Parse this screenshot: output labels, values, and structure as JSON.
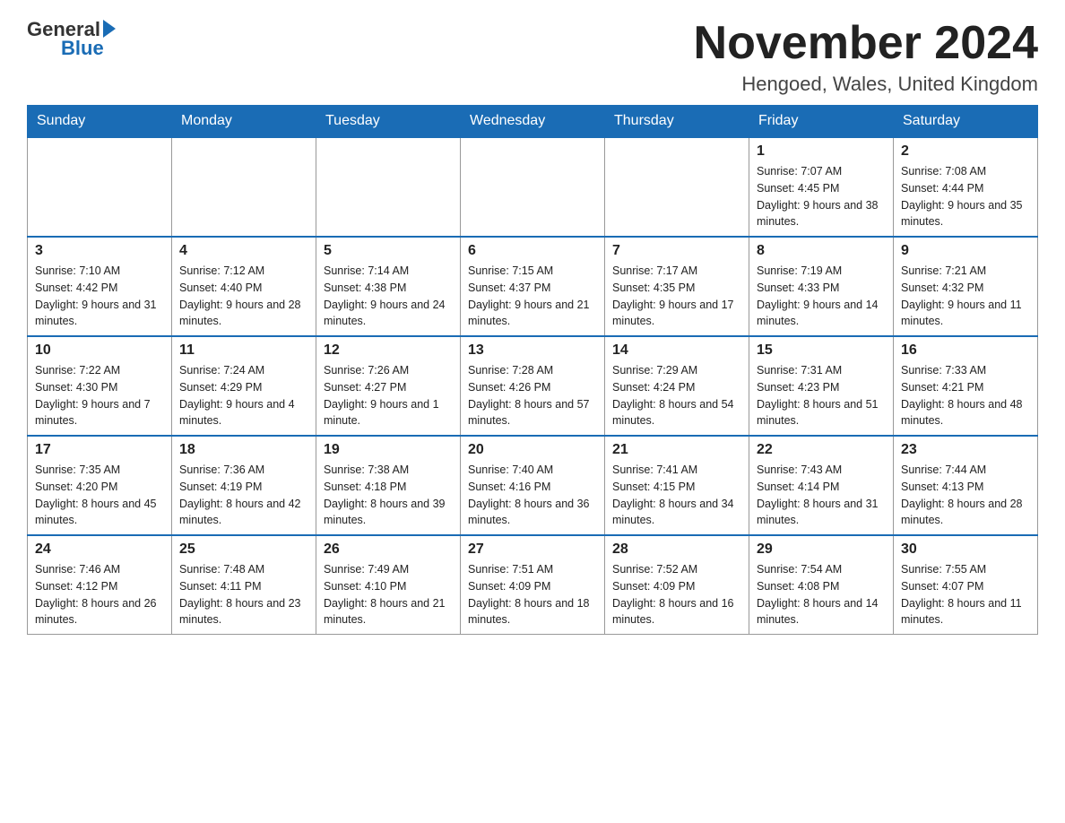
{
  "header": {
    "logo_general": "General",
    "logo_blue": "Blue",
    "month_title": "November 2024",
    "location": "Hengoed, Wales, United Kingdom"
  },
  "days_of_week": [
    "Sunday",
    "Monday",
    "Tuesday",
    "Wednesday",
    "Thursday",
    "Friday",
    "Saturday"
  ],
  "weeks": [
    [
      {
        "day": "",
        "sunrise": "",
        "sunset": "",
        "daylight": ""
      },
      {
        "day": "",
        "sunrise": "",
        "sunset": "",
        "daylight": ""
      },
      {
        "day": "",
        "sunrise": "",
        "sunset": "",
        "daylight": ""
      },
      {
        "day": "",
        "sunrise": "",
        "sunset": "",
        "daylight": ""
      },
      {
        "day": "",
        "sunrise": "",
        "sunset": "",
        "daylight": ""
      },
      {
        "day": "1",
        "sunrise": "Sunrise: 7:07 AM",
        "sunset": "Sunset: 4:45 PM",
        "daylight": "Daylight: 9 hours and 38 minutes."
      },
      {
        "day": "2",
        "sunrise": "Sunrise: 7:08 AM",
        "sunset": "Sunset: 4:44 PM",
        "daylight": "Daylight: 9 hours and 35 minutes."
      }
    ],
    [
      {
        "day": "3",
        "sunrise": "Sunrise: 7:10 AM",
        "sunset": "Sunset: 4:42 PM",
        "daylight": "Daylight: 9 hours and 31 minutes."
      },
      {
        "day": "4",
        "sunrise": "Sunrise: 7:12 AM",
        "sunset": "Sunset: 4:40 PM",
        "daylight": "Daylight: 9 hours and 28 minutes."
      },
      {
        "day": "5",
        "sunrise": "Sunrise: 7:14 AM",
        "sunset": "Sunset: 4:38 PM",
        "daylight": "Daylight: 9 hours and 24 minutes."
      },
      {
        "day": "6",
        "sunrise": "Sunrise: 7:15 AM",
        "sunset": "Sunset: 4:37 PM",
        "daylight": "Daylight: 9 hours and 21 minutes."
      },
      {
        "day": "7",
        "sunrise": "Sunrise: 7:17 AM",
        "sunset": "Sunset: 4:35 PM",
        "daylight": "Daylight: 9 hours and 17 minutes."
      },
      {
        "day": "8",
        "sunrise": "Sunrise: 7:19 AM",
        "sunset": "Sunset: 4:33 PM",
        "daylight": "Daylight: 9 hours and 14 minutes."
      },
      {
        "day": "9",
        "sunrise": "Sunrise: 7:21 AM",
        "sunset": "Sunset: 4:32 PM",
        "daylight": "Daylight: 9 hours and 11 minutes."
      }
    ],
    [
      {
        "day": "10",
        "sunrise": "Sunrise: 7:22 AM",
        "sunset": "Sunset: 4:30 PM",
        "daylight": "Daylight: 9 hours and 7 minutes."
      },
      {
        "day": "11",
        "sunrise": "Sunrise: 7:24 AM",
        "sunset": "Sunset: 4:29 PM",
        "daylight": "Daylight: 9 hours and 4 minutes."
      },
      {
        "day": "12",
        "sunrise": "Sunrise: 7:26 AM",
        "sunset": "Sunset: 4:27 PM",
        "daylight": "Daylight: 9 hours and 1 minute."
      },
      {
        "day": "13",
        "sunrise": "Sunrise: 7:28 AM",
        "sunset": "Sunset: 4:26 PM",
        "daylight": "Daylight: 8 hours and 57 minutes."
      },
      {
        "day": "14",
        "sunrise": "Sunrise: 7:29 AM",
        "sunset": "Sunset: 4:24 PM",
        "daylight": "Daylight: 8 hours and 54 minutes."
      },
      {
        "day": "15",
        "sunrise": "Sunrise: 7:31 AM",
        "sunset": "Sunset: 4:23 PM",
        "daylight": "Daylight: 8 hours and 51 minutes."
      },
      {
        "day": "16",
        "sunrise": "Sunrise: 7:33 AM",
        "sunset": "Sunset: 4:21 PM",
        "daylight": "Daylight: 8 hours and 48 minutes."
      }
    ],
    [
      {
        "day": "17",
        "sunrise": "Sunrise: 7:35 AM",
        "sunset": "Sunset: 4:20 PM",
        "daylight": "Daylight: 8 hours and 45 minutes."
      },
      {
        "day": "18",
        "sunrise": "Sunrise: 7:36 AM",
        "sunset": "Sunset: 4:19 PM",
        "daylight": "Daylight: 8 hours and 42 minutes."
      },
      {
        "day": "19",
        "sunrise": "Sunrise: 7:38 AM",
        "sunset": "Sunset: 4:18 PM",
        "daylight": "Daylight: 8 hours and 39 minutes."
      },
      {
        "day": "20",
        "sunrise": "Sunrise: 7:40 AM",
        "sunset": "Sunset: 4:16 PM",
        "daylight": "Daylight: 8 hours and 36 minutes."
      },
      {
        "day": "21",
        "sunrise": "Sunrise: 7:41 AM",
        "sunset": "Sunset: 4:15 PM",
        "daylight": "Daylight: 8 hours and 34 minutes."
      },
      {
        "day": "22",
        "sunrise": "Sunrise: 7:43 AM",
        "sunset": "Sunset: 4:14 PM",
        "daylight": "Daylight: 8 hours and 31 minutes."
      },
      {
        "day": "23",
        "sunrise": "Sunrise: 7:44 AM",
        "sunset": "Sunset: 4:13 PM",
        "daylight": "Daylight: 8 hours and 28 minutes."
      }
    ],
    [
      {
        "day": "24",
        "sunrise": "Sunrise: 7:46 AM",
        "sunset": "Sunset: 4:12 PM",
        "daylight": "Daylight: 8 hours and 26 minutes."
      },
      {
        "day": "25",
        "sunrise": "Sunrise: 7:48 AM",
        "sunset": "Sunset: 4:11 PM",
        "daylight": "Daylight: 8 hours and 23 minutes."
      },
      {
        "day": "26",
        "sunrise": "Sunrise: 7:49 AM",
        "sunset": "Sunset: 4:10 PM",
        "daylight": "Daylight: 8 hours and 21 minutes."
      },
      {
        "day": "27",
        "sunrise": "Sunrise: 7:51 AM",
        "sunset": "Sunset: 4:09 PM",
        "daylight": "Daylight: 8 hours and 18 minutes."
      },
      {
        "day": "28",
        "sunrise": "Sunrise: 7:52 AM",
        "sunset": "Sunset: 4:09 PM",
        "daylight": "Daylight: 8 hours and 16 minutes."
      },
      {
        "day": "29",
        "sunrise": "Sunrise: 7:54 AM",
        "sunset": "Sunset: 4:08 PM",
        "daylight": "Daylight: 8 hours and 14 minutes."
      },
      {
        "day": "30",
        "sunrise": "Sunrise: 7:55 AM",
        "sunset": "Sunset: 4:07 PM",
        "daylight": "Daylight: 8 hours and 11 minutes."
      }
    ]
  ]
}
